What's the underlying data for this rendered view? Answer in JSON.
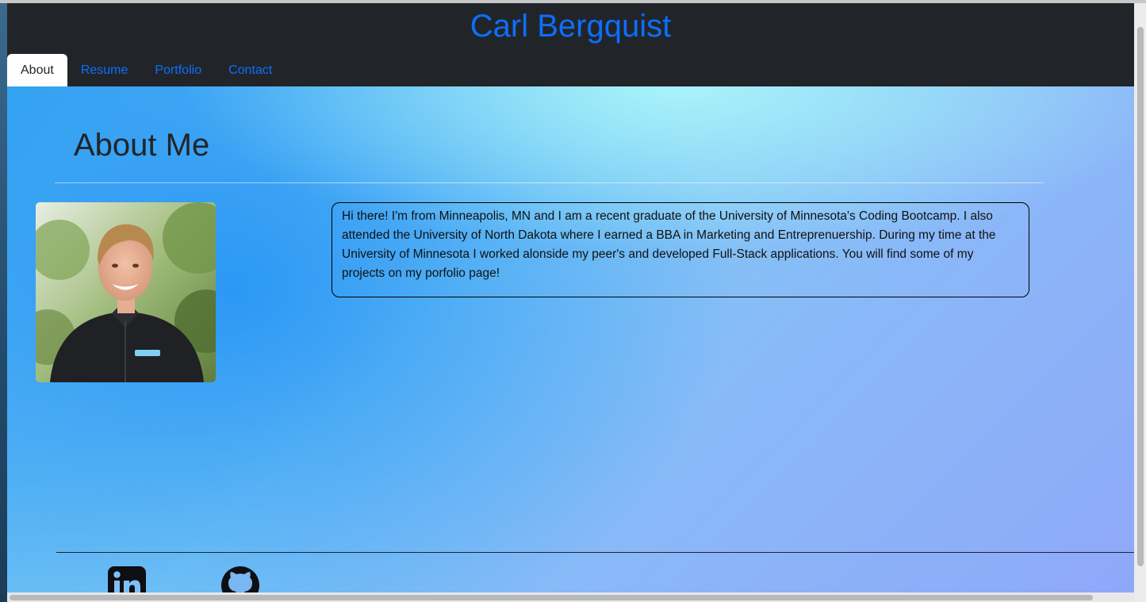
{
  "header": {
    "site_title": "Carl Bergquist"
  },
  "nav": {
    "tabs": [
      {
        "label": "About",
        "active": true
      },
      {
        "label": "Resume",
        "active": false
      },
      {
        "label": "Portfolio",
        "active": false
      },
      {
        "label": "Contact",
        "active": false
      }
    ]
  },
  "about": {
    "heading": "About Me",
    "bio": "Hi there! I'm from Minneapolis, MN and I am a recent graduate of the University of Minnesota's Coding Bootcamp. I also attended the University of North Dakota where I earned a BBA in Marketing and Entreprenuership. During my time at the University of Minnesota I worked alonside my peer's and developed Full-Stack applications. You will find some of my projects on my porfolio page!",
    "photo_icon": "profile-photo"
  },
  "footer": {
    "social": [
      {
        "icon": "linkedin-icon"
      },
      {
        "icon": "github-icon"
      }
    ]
  },
  "colors": {
    "header_bg": "#212529",
    "accent": "#0d6efd",
    "text_dark": "#212529"
  }
}
